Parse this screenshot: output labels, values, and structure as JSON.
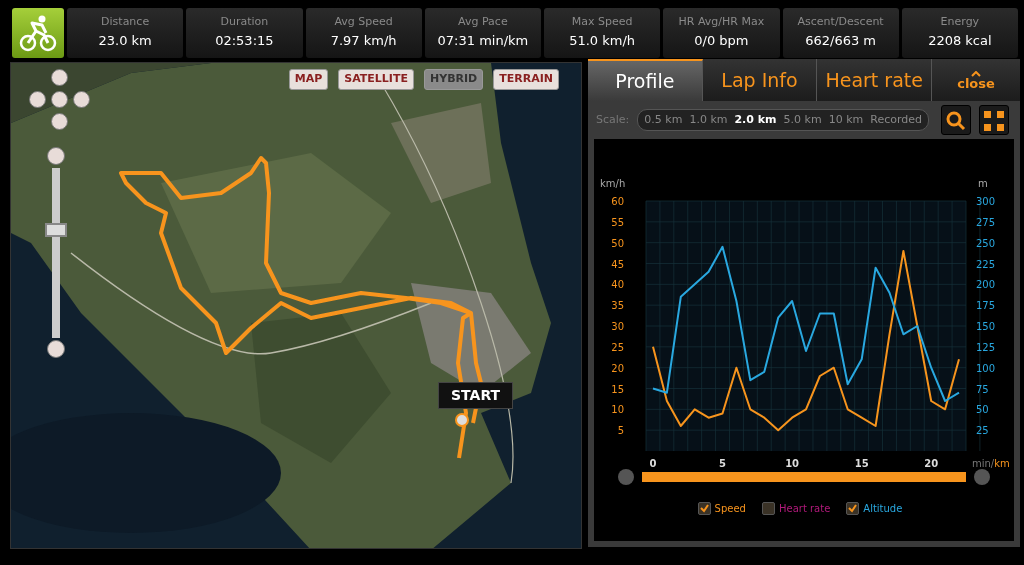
{
  "stats": [
    {
      "label": "Distance",
      "value": "23.0 km"
    },
    {
      "label": "Duration",
      "value": "02:53:15"
    },
    {
      "label": "Avg Speed",
      "value": "7.97 km/h"
    },
    {
      "label": "Avg Pace",
      "value": "07:31 min/km"
    },
    {
      "label": "Max Speed",
      "value": "51.0 km/h"
    },
    {
      "label": "HR Avg/HR Max",
      "value": "0/0 bpm"
    },
    {
      "label": "Ascent/Descent",
      "value": "662/663 m"
    },
    {
      "label": "Energy",
      "value": "2208 kcal"
    }
  ],
  "map": {
    "kind": "picture",
    "map_types": [
      {
        "label": "MAP",
        "selected": false
      },
      {
        "label": "SATELLITE",
        "selected": false
      },
      {
        "label": "HYBRID",
        "selected": true
      },
      {
        "label": "TERRAIN",
        "selected": false
      }
    ],
    "zoom": {
      "level": 0.65
    },
    "start_label": "START"
  },
  "tabs": [
    {
      "label": "Profile",
      "selected": true
    },
    {
      "label": "Lap Info",
      "selected": false
    },
    {
      "label": "Heart rate",
      "selected": false
    }
  ],
  "close_label": "close",
  "scale": {
    "label": "Scale:",
    "options": [
      {
        "label": "0.5 km",
        "selected": false
      },
      {
        "label": "1.0 km",
        "selected": false
      },
      {
        "label": "2.0 km",
        "selected": true
      },
      {
        "label": "5.0 km",
        "selected": false
      },
      {
        "label": "10 km",
        "selected": false
      },
      {
        "label": "Recorded",
        "selected": false
      }
    ]
  },
  "speed_chart": {
    "chart_data": {
      "type": "line",
      "ylabel": "km/h",
      "grid": true,
      "ylim": [
        0,
        60
      ],
      "xlim": [
        -0.5,
        22.5
      ],
      "xticks": [
        0,
        5,
        10,
        15,
        20
      ],
      "yticks": [
        5,
        10,
        15,
        20,
        25,
        30,
        35,
        40,
        45,
        50,
        55,
        60
      ],
      "x": [
        0,
        1,
        2,
        3,
        4,
        5,
        6,
        7,
        8,
        9,
        10,
        11,
        12,
        13,
        14,
        15,
        16,
        17,
        18,
        19,
        20,
        21,
        22
      ],
      "series": [
        {
          "color": "#f7941d",
          "values": [
            25,
            12,
            6,
            10,
            8,
            9,
            20,
            10,
            8,
            5,
            8,
            10,
            18,
            20,
            10,
            8,
            6,
            28,
            48,
            30,
            12,
            10,
            22
          ]
        }
      ]
    }
  },
  "altitude_chart": {
    "chart_data": {
      "type": "line",
      "ylabel": "m",
      "ylim": [
        0,
        300
      ],
      "xlim": [
        -0.5,
        22.5
      ],
      "yticks": [
        25,
        50,
        75,
        100,
        125,
        150,
        175,
        200,
        225,
        250,
        275,
        300
      ],
      "x": [
        0,
        1,
        2,
        3,
        4,
        5,
        6,
        7,
        8,
        9,
        10,
        11,
        12,
        13,
        14,
        15,
        16,
        17,
        18,
        19,
        20,
        21,
        22
      ],
      "series": [
        {
          "color": "#29a8e0",
          "values": [
            75,
            70,
            185,
            200,
            215,
            245,
            180,
            85,
            95,
            160,
            180,
            120,
            165,
            165,
            80,
            110,
            220,
            190,
            140,
            150,
            100,
            60,
            70
          ]
        }
      ]
    }
  },
  "x_units": {
    "separator": "/",
    "options": [
      {
        "label": "min",
        "selected": false
      },
      {
        "label": "km",
        "selected": true
      }
    ]
  },
  "range": {
    "level": 1
  },
  "legend": [
    {
      "label": "Speed",
      "checked": true,
      "color": "#f7941d"
    },
    {
      "label": "Heart rate",
      "checked": false,
      "color": "#b0197a"
    },
    {
      "label": "Altitude",
      "checked": true,
      "color": "#29a8e0"
    }
  ]
}
